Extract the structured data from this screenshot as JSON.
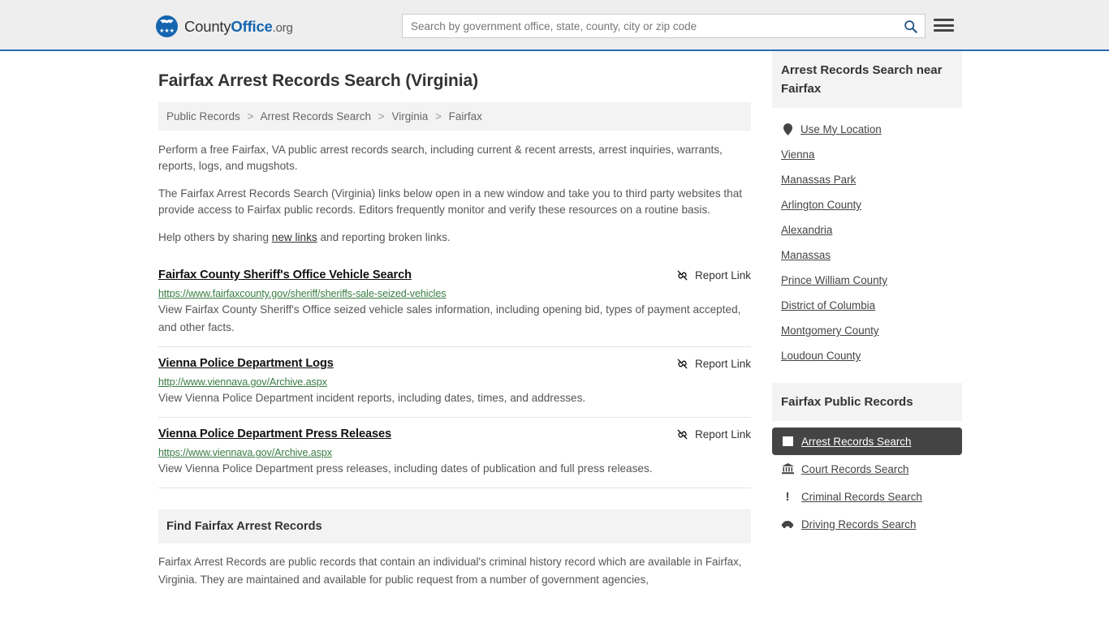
{
  "header": {
    "brand": {
      "county": "County",
      "office": "Office",
      "org": ".org"
    },
    "search": {
      "placeholder": "Search by government office, state, county, city or zip code",
      "value": ""
    },
    "accent_color": "#1565b0",
    "background_color": "#eeeeee"
  },
  "main": {
    "title": "Fairfax Arrest Records Search (Virginia)",
    "breadcrumb": [
      "Public Records",
      "Arrest Records Search",
      "Virginia",
      "Fairfax"
    ],
    "breadcrumb_separator": ">",
    "paragraphs": {
      "p1": "Perform a free Fairfax, VA public arrest records search, including current & recent arrests, arrest inquiries, warrants, reports, logs, and mugshots.",
      "p2": "The Fairfax Arrest Records Search (Virginia) links below open in a new window and take you to third party websites that provide access to Fairfax public records. Editors frequently monitor and verify these resources on a routine basis.",
      "p3_before": "Help others by sharing ",
      "p3_link": "new links",
      "p3_after": " and reporting broken links."
    },
    "report_link_label": "Report Link",
    "results": [
      {
        "title": "Fairfax County Sheriff's Office Vehicle Search",
        "url": "https://www.fairfaxcounty.gov/sheriff/sheriffs-sale-seized-vehicles",
        "description": "View Fairfax County Sheriff's Office seized vehicle sales information, including opening bid, types of payment accepted, and other facts."
      },
      {
        "title": "Vienna Police Department Logs",
        "url": "http://www.viennava.gov/Archive.aspx",
        "description": "View Vienna Police Department incident reports, including dates, times, and addresses."
      },
      {
        "title": "Vienna Police Department Press Releases",
        "url": "https://www.viennava.gov/Archive.aspx",
        "description": "View Vienna Police Department press releases, including dates of publication and full press releases."
      }
    ],
    "find_section": {
      "heading": "Find Fairfax Arrest Records",
      "body": "Fairfax Arrest Records are public records that contain an individual's criminal history record which are available in Fairfax, Virginia. They are maintained and available for public request from a number of government agencies,"
    }
  },
  "sidebar": {
    "near": {
      "heading": "Arrest Records Search near Fairfax",
      "use_my_location": "Use My Location",
      "items": [
        "Vienna",
        "Manassas Park",
        "Arlington County",
        "Alexandria",
        "Manassas",
        "Prince William County",
        "District of Columbia",
        "Montgomery County",
        "Loudoun County"
      ]
    },
    "public_records": {
      "heading": "Fairfax Public Records",
      "items": [
        {
          "label": "Arrest Records Search",
          "icon": "id-card-icon",
          "active": true
        },
        {
          "label": "Court Records Search",
          "icon": "bank-icon",
          "active": false
        },
        {
          "label": "Criminal Records Search",
          "icon": "exclamation-icon",
          "active": false
        },
        {
          "label": "Driving Records Search",
          "icon": "car-icon",
          "active": false
        }
      ],
      "active_background": "#444444"
    }
  }
}
